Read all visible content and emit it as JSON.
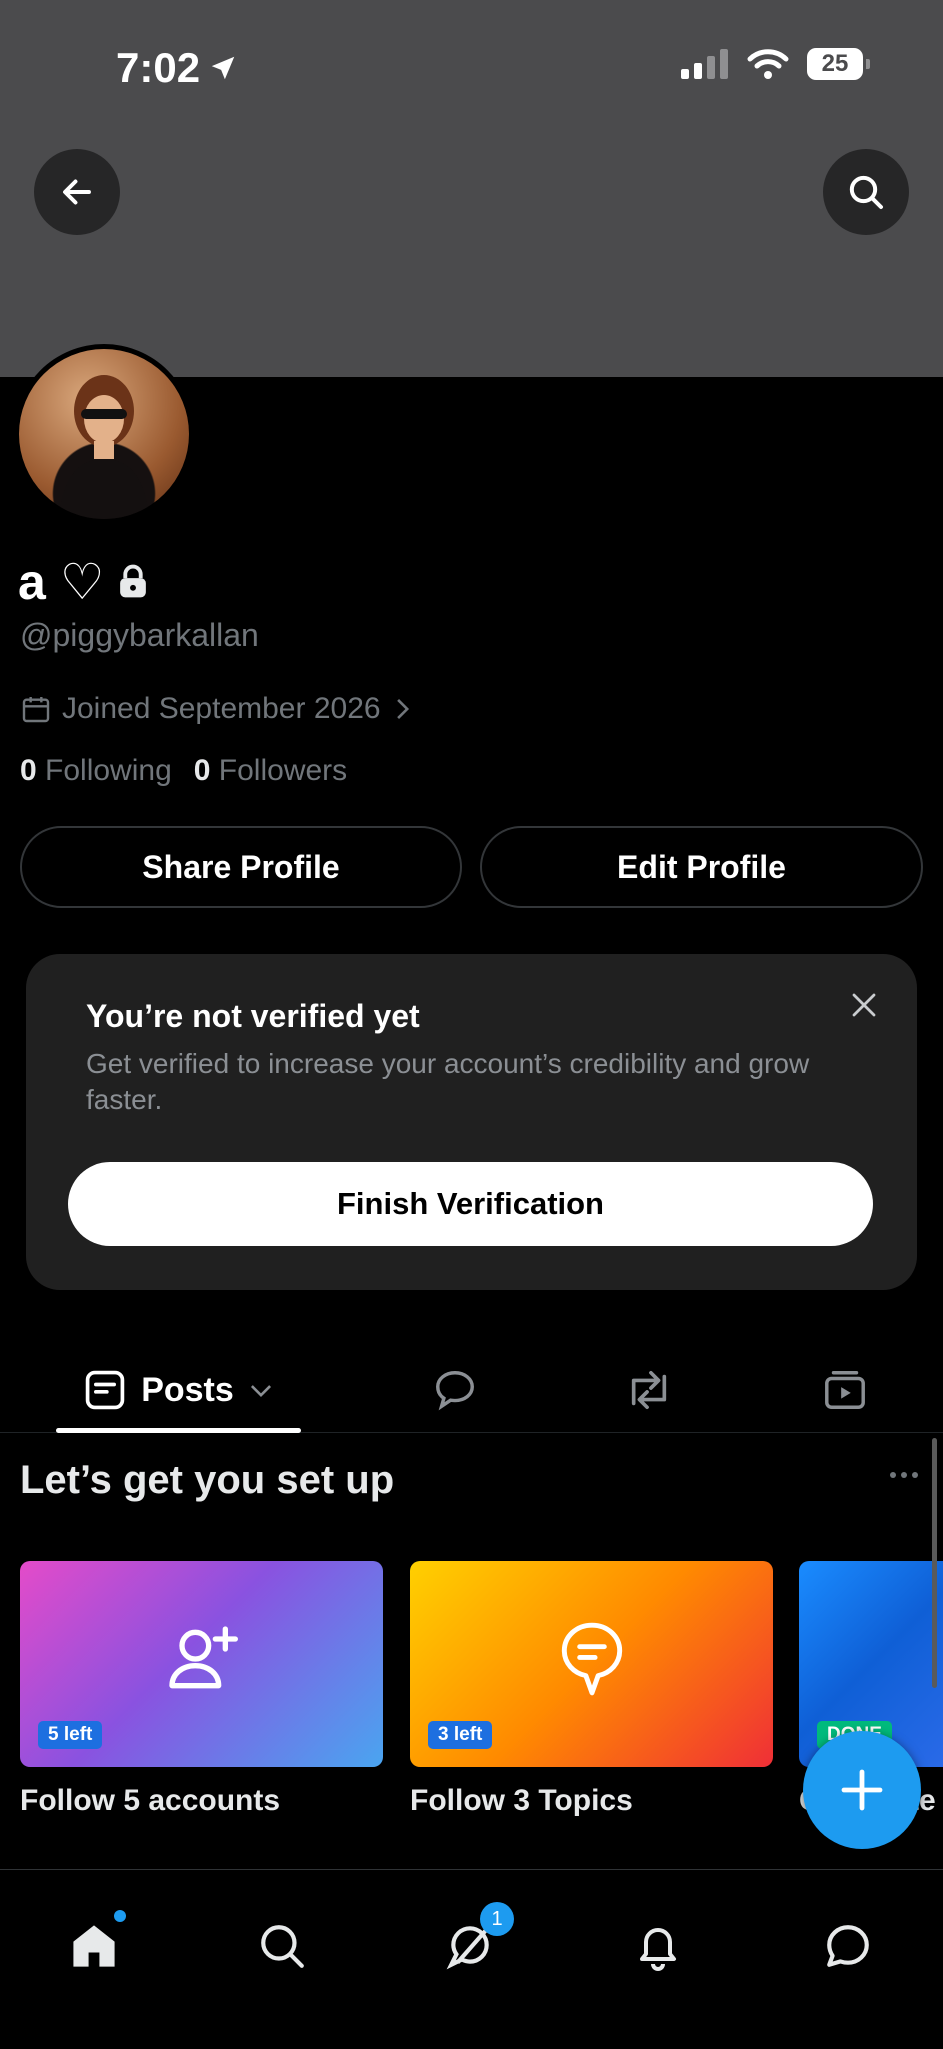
{
  "status_bar": {
    "time": "7:02",
    "battery": "25"
  },
  "profile": {
    "name": "a ♡",
    "handle": "@piggybarkallan",
    "joined": "Joined September 2026",
    "following_count": "0",
    "following_label": "Following",
    "followers_count": "0",
    "followers_label": "Followers",
    "share_label": "Share Profile",
    "edit_label": "Edit Profile"
  },
  "verify_card": {
    "title": "You’re not verified yet",
    "text": "Get verified to increase your account’s credibility and grow faster.",
    "button": "Finish Verification"
  },
  "tabs": {
    "posts_label": "Posts"
  },
  "setup": {
    "title": "Let’s get you set up",
    "tiles": [
      {
        "badge": "5 left",
        "label": "Follow 5 accounts"
      },
      {
        "badge": "3 left",
        "label": "Follow 3 Topics"
      },
      {
        "badge": "DONE",
        "label": "Complete"
      }
    ]
  },
  "nav": {
    "messages_badge": "1"
  },
  "colors": {
    "accent": "#1d9bf0",
    "banner": "#4b4b4d",
    "muted": "#71767b"
  }
}
